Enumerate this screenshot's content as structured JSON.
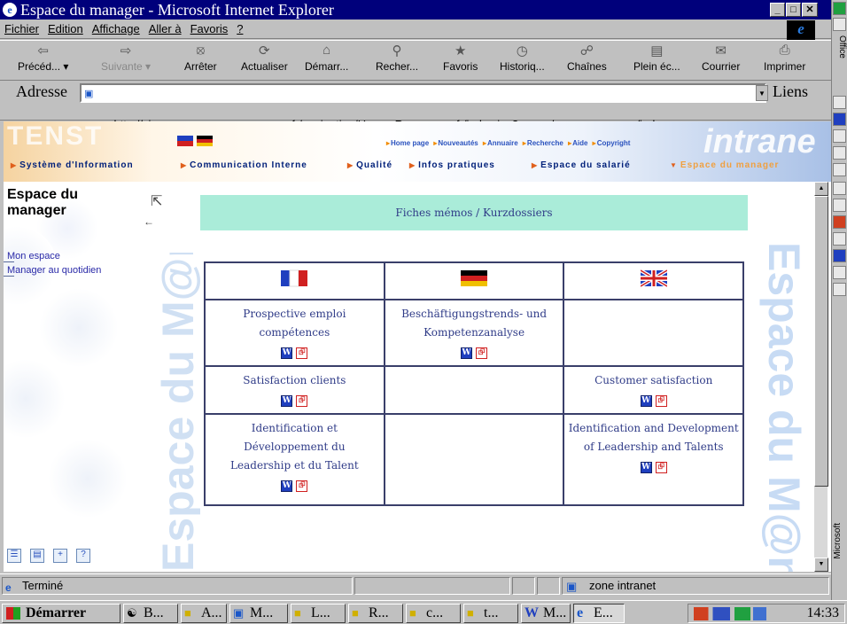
{
  "window": {
    "title": "Espace du manager - Microsoft Internet Explorer",
    "title_bg": "#00007b"
  },
  "menu": [
    "Fichier",
    "Edition",
    "Affichage",
    "Aller à",
    "Favoris",
    "?"
  ],
  "toolbar": {
    "back": "Précéd...",
    "forward": "Suivante",
    "stop": "Arrêter",
    "refresh": "Actualiser",
    "home": "Démarr...",
    "search": "Recher...",
    "favorites": "Favoris",
    "history": "Historiq...",
    "channels": "Chaînes",
    "fullscreen": "Plein éc...",
    "mail": "Courrier",
    "print": "Imprimer"
  },
  "address": {
    "label": "Adresse",
    "url": "http://simenon.ma.                          fr/navigation/HumanResources_fr/index.jsp?page=/espacemanager/index.asp",
    "links_label": "Liens"
  },
  "banner": {
    "toplinks": [
      "Home page",
      "Nouveautés",
      "Annuaire",
      "Recherche",
      "Aide",
      "Copyright"
    ],
    "nav": [
      "Système d'Information",
      "Communication Interne",
      "Qualité",
      "Infos pratiques",
      "Espace du salarié",
      "Espace du manager"
    ]
  },
  "sidebar": {
    "title": "Espace du manager",
    "links": [
      "Mon espace",
      "Manager au quotidien"
    ]
  },
  "content": {
    "header": "Fiches mémos / Kurzdossiers",
    "watermark_left": "Espace du M@nager",
    "watermark_right": "Espace du M@n",
    "rows": [
      {
        "fr": "Prospective emploi compétences",
        "de": "Beschäftigungstrends- und Kompetenzanalyse",
        "en": ""
      },
      {
        "fr": "Satisfaction clients",
        "de": "",
        "en": "Customer satisfaction"
      },
      {
        "fr": "Identification et Développement du Leadership et du Talent",
        "de": "",
        "en": "Identification and Development of Leadership and Talents"
      }
    ],
    "doc_icon_word": "W",
    "doc_icon_pdf": "⮺"
  },
  "status": {
    "text": "Terminé",
    "zone": "zone intranet"
  },
  "taskbar": {
    "start": "Démarrer",
    "items": [
      "B...",
      "A...",
      "M...",
      "L...",
      "R...",
      "c...",
      "t...",
      "M...",
      "E..."
    ],
    "clock": "14:33"
  },
  "right_toolbar": {
    "top_label": "Office",
    "bottom_label": "Microsoft"
  }
}
